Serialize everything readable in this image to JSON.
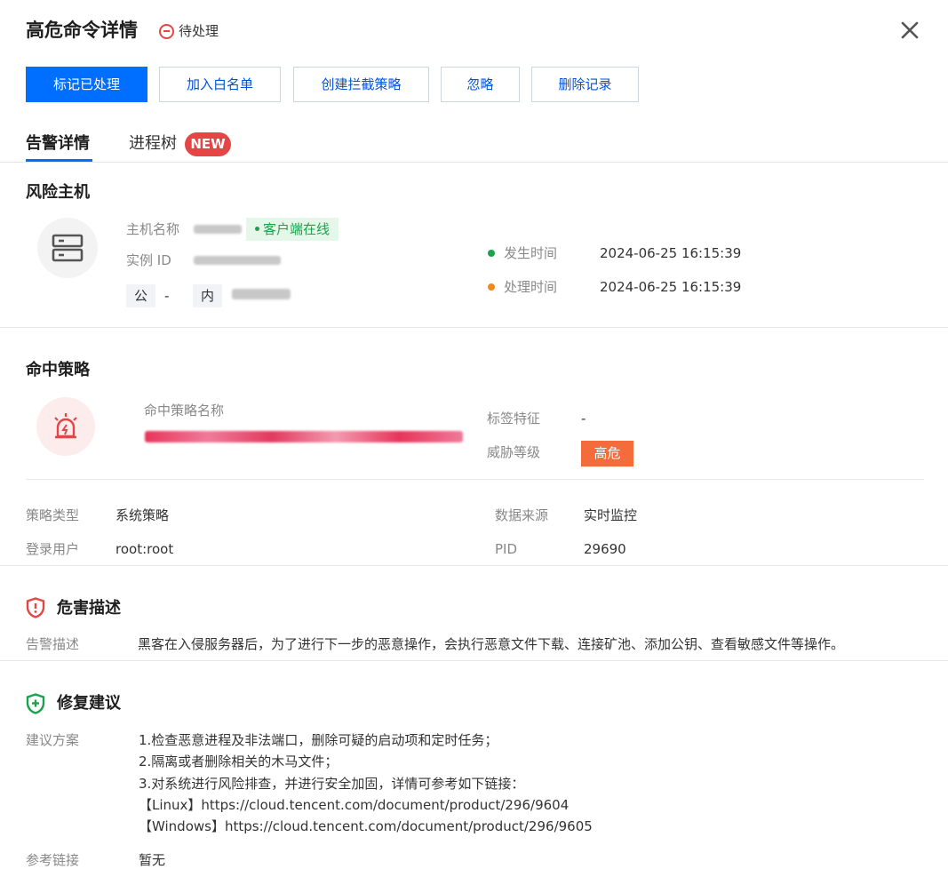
{
  "header": {
    "title": "高危命令详情",
    "status": "待处理",
    "close_icon": "close-icon"
  },
  "actions": {
    "mark_handled": "标记已处理",
    "add_whitelist": "加入白名单",
    "create_block_policy": "创建拦截策略",
    "ignore": "忽略",
    "delete_record": "删除记录"
  },
  "tabs": {
    "alert_detail": "告警详情",
    "process_tree": "进程树",
    "new_badge": "NEW"
  },
  "risk_host": {
    "section_title": "风险主机",
    "hostname_label": "主机名称",
    "client_status": "客户端在线",
    "instance_id_label": "实例 ID",
    "public_ip_label": "公",
    "public_ip_value": "-",
    "private_ip_label": "内",
    "occurred_label": "发生时间",
    "occurred_value": "2024-06-25 16:15:39",
    "handled_label": "处理时间",
    "handled_value": "2024-06-25 16:15:39"
  },
  "hit_policy": {
    "section_title": "命中策略",
    "policy_name_label": "命中策略名称",
    "tag_label": "标签特征",
    "tag_value": "-",
    "threat_level_label": "威胁等级",
    "threat_level_value": "高危",
    "policy_type_label": "策略类型",
    "policy_type_value": "系统策略",
    "data_source_label": "数据来源",
    "data_source_value": "实时监控",
    "login_user_label": "登录用户",
    "login_user_value": "root:root",
    "pid_label": "PID",
    "pid_value": "29690"
  },
  "harm": {
    "section_title": "危害描述",
    "desc_label": "告警描述",
    "desc_value": "黑客在入侵服务器后，为了进行下一步的恶意操作，会执行恶意文件下载、连接矿池、添加公钥、查看敏感文件等操作。"
  },
  "fix": {
    "section_title": "修复建议",
    "plan_label": "建议方案",
    "lines": [
      "1.检查恶意进程及非法端口，删除可疑的启动项和定时任务；",
      "2.隔离或者删除相关的木马文件；",
      "3.对系统进行风险排查，并进行安全加固，详情可参考如下链接：",
      "【Linux】https://cloud.tencent.com/document/product/296/9604",
      "【Windows】https://cloud.tencent.com/document/product/296/9605"
    ],
    "ref_label": "参考链接",
    "ref_value": "暂无"
  },
  "colors": {
    "primary": "#006eff",
    "danger": "#e54545",
    "high_level": "#f56c3c",
    "online_green": "#1aa34a",
    "fix_green": "#1aa34a"
  }
}
